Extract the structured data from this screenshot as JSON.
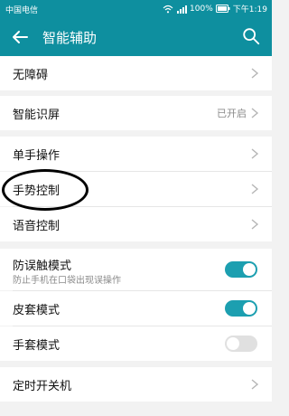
{
  "status_bar": {
    "carrier": "中国电信",
    "battery": "100%",
    "time": "下午1:19"
  },
  "header": {
    "title": "智能辅助"
  },
  "settings": [
    {
      "label": "无障碍"
    },
    {
      "label": "智能识屏",
      "value": "已开启"
    },
    {
      "label": "单手操作"
    },
    {
      "label": "手势控制"
    },
    {
      "label": "语音控制"
    },
    {
      "label": "防误触模式",
      "sub": "防止手机在口袋出现误操作",
      "toggle": true
    },
    {
      "label": "皮套模式",
      "toggle": true
    },
    {
      "label": "手套模式",
      "toggle": false
    },
    {
      "label": "定时开关机"
    }
  ],
  "colors": {
    "accent": "#0e8f9f",
    "toggle_on": "#1c9fb0",
    "toggle_off": "#e0e0e0"
  }
}
